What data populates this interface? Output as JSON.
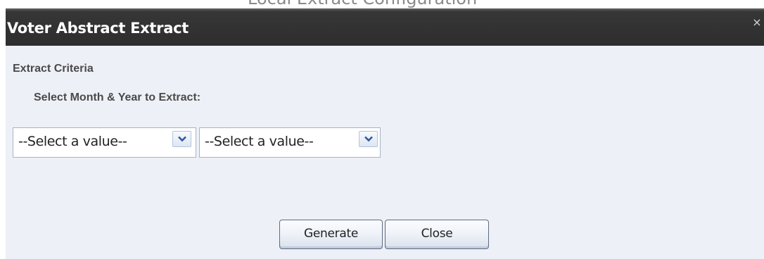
{
  "background_window": {
    "title": "Local Extract Configuration"
  },
  "dialog": {
    "title": "Voter Abstract Extract",
    "close_glyph": "×",
    "section_label": "Extract Criteria",
    "prompt_label": "Select Month & Year to Extract:",
    "month_select": {
      "value": "--Select a value--",
      "icon": "chevron-down-icon"
    },
    "year_select": {
      "value": "--Select a value--",
      "icon": "chevron-down-icon"
    },
    "buttons": {
      "generate": "Generate",
      "close": "Close"
    }
  },
  "colors": {
    "header_bg": "#333333",
    "dialog_bg": "#eef0f7",
    "label_text": "#4a4a4a",
    "arrow_color": "#2c5ba3"
  }
}
